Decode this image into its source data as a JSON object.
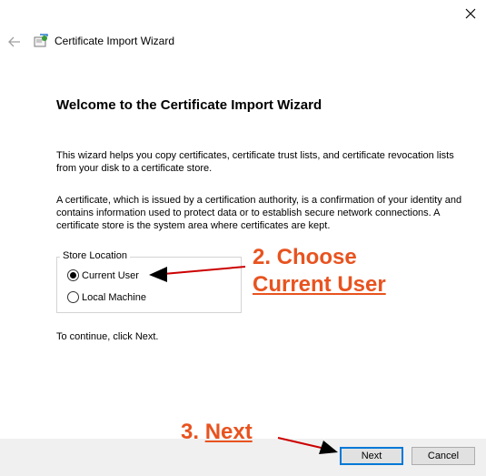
{
  "window": {
    "title": "Certificate Import Wizard",
    "close_icon": "close-icon",
    "back_icon": "back-arrow-icon",
    "title_icon": "certificate-icon"
  },
  "main": {
    "heading": "Welcome to the Certificate Import Wizard",
    "paragraph1": "This wizard helps you copy certificates, certificate trust lists, and certificate revocation lists from your disk to a certificate store.",
    "paragraph2": "A certificate, which is issued by a certification authority, is a confirmation of your identity and contains information used to protect data or to establish secure network connections. A certificate store is the system area where certificates are kept.",
    "store_location": {
      "legend": "Store Location",
      "options": [
        {
          "label": "Current User",
          "checked": true
        },
        {
          "label": "Local Machine",
          "checked": false
        }
      ]
    },
    "continue_text": "To continue, click Next."
  },
  "footer": {
    "next_label": "Next",
    "cancel_label": "Cancel"
  },
  "annotations": {
    "choose_line1": "2. Choose",
    "choose_line2": "Current User",
    "next_prefix": "3. ",
    "next_word": "Next",
    "color": "#e8531f",
    "arrow_color": "#cc0000"
  }
}
